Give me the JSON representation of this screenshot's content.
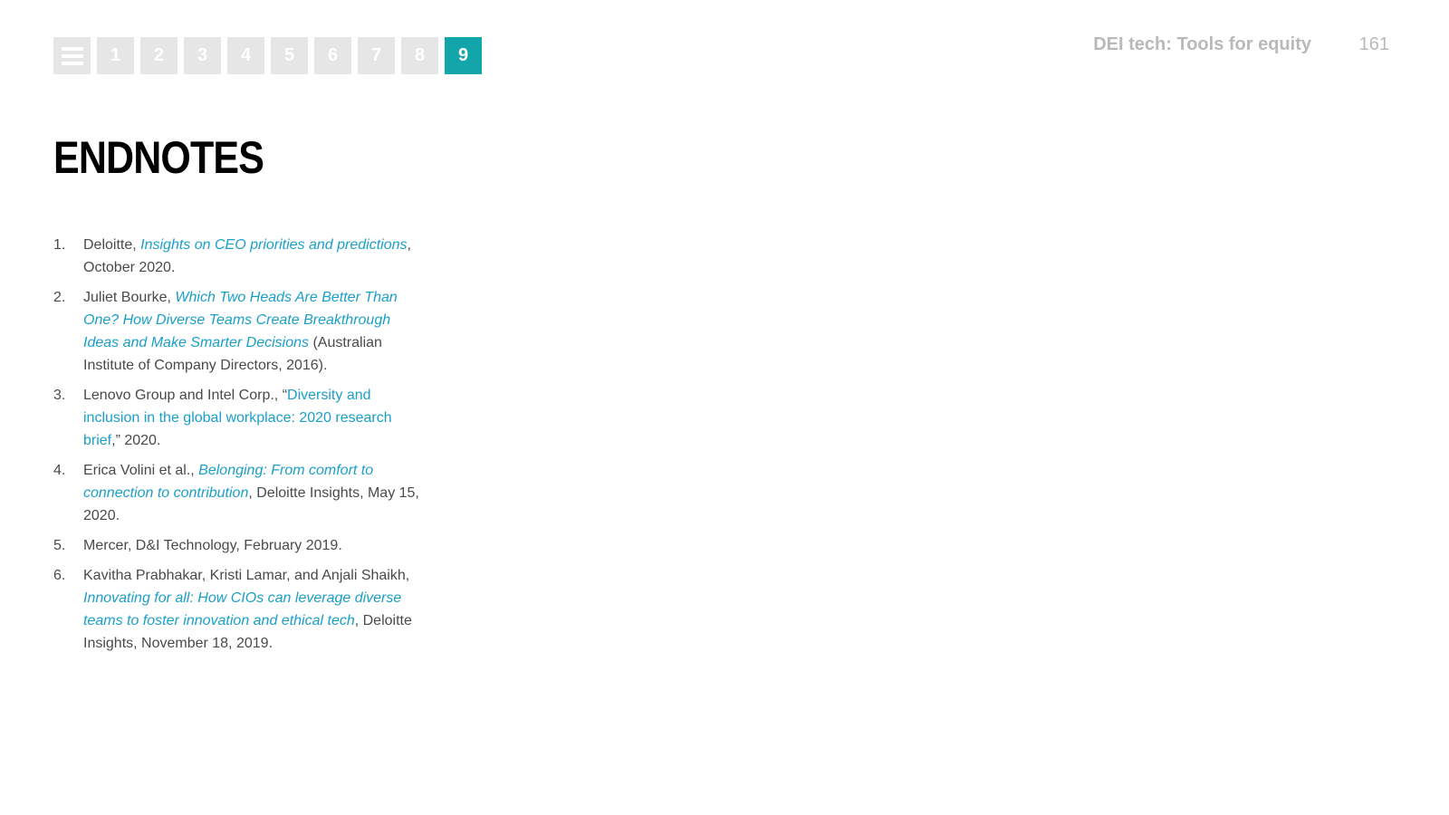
{
  "nav": {
    "menu_icon": "hamburger-menu-icon",
    "pages": [
      {
        "label": "1",
        "active": false
      },
      {
        "label": "2",
        "active": false
      },
      {
        "label": "3",
        "active": false
      },
      {
        "label": "4",
        "active": false
      },
      {
        "label": "5",
        "active": false
      },
      {
        "label": "6",
        "active": false
      },
      {
        "label": "7",
        "active": false
      },
      {
        "label": "8",
        "active": false
      },
      {
        "label": "9",
        "active": true
      }
    ]
  },
  "header": {
    "title": "DEI tech: Tools for equity",
    "page_number": "161"
  },
  "heading": "ENDNOTES",
  "colors": {
    "accent": "#12a6aa",
    "link": "#1a9fc9",
    "nav_inactive": "#e6e6e6",
    "header_text": "#b9b9b9"
  },
  "endnotes": [
    {
      "num": "1.",
      "pre": "Deloitte, ",
      "link": "Insights on CEO priorities and predictions",
      "post": ", October 2020."
    },
    {
      "num": "2.",
      "pre": "Juliet Bourke, ",
      "link": "Which Two Heads Are Better Than One? How Diverse Teams Create Breakthrough Ideas and Make Smarter Decisions",
      "post": " (Australian Institute of Company Directors, 2016)."
    },
    {
      "num": "3.",
      "pre": "Lenovo Group and Intel Corp., “",
      "link": "Diversity and inclusion in the global workplace: 2020 research brief",
      "post": ",” 2020."
    },
    {
      "num": "4.",
      "pre": "Erica Volini et al., ",
      "link": "Belonging: From comfort to connection to contribution",
      "post": ", Deloitte Insights, May 15, 2020."
    },
    {
      "num": "5.",
      "pre": "Mercer, D&I Technology, February 2019.",
      "link": "",
      "post": ""
    },
    {
      "num": "6.",
      "pre": "Kavitha Prabhakar, Kristi Lamar, and Anjali Shaikh, ",
      "link": "Innovating for all: How CIOs can leverage diverse teams to foster innovation and ethical tech",
      "post": ", Deloitte Insights, November 18, 2019."
    }
  ]
}
